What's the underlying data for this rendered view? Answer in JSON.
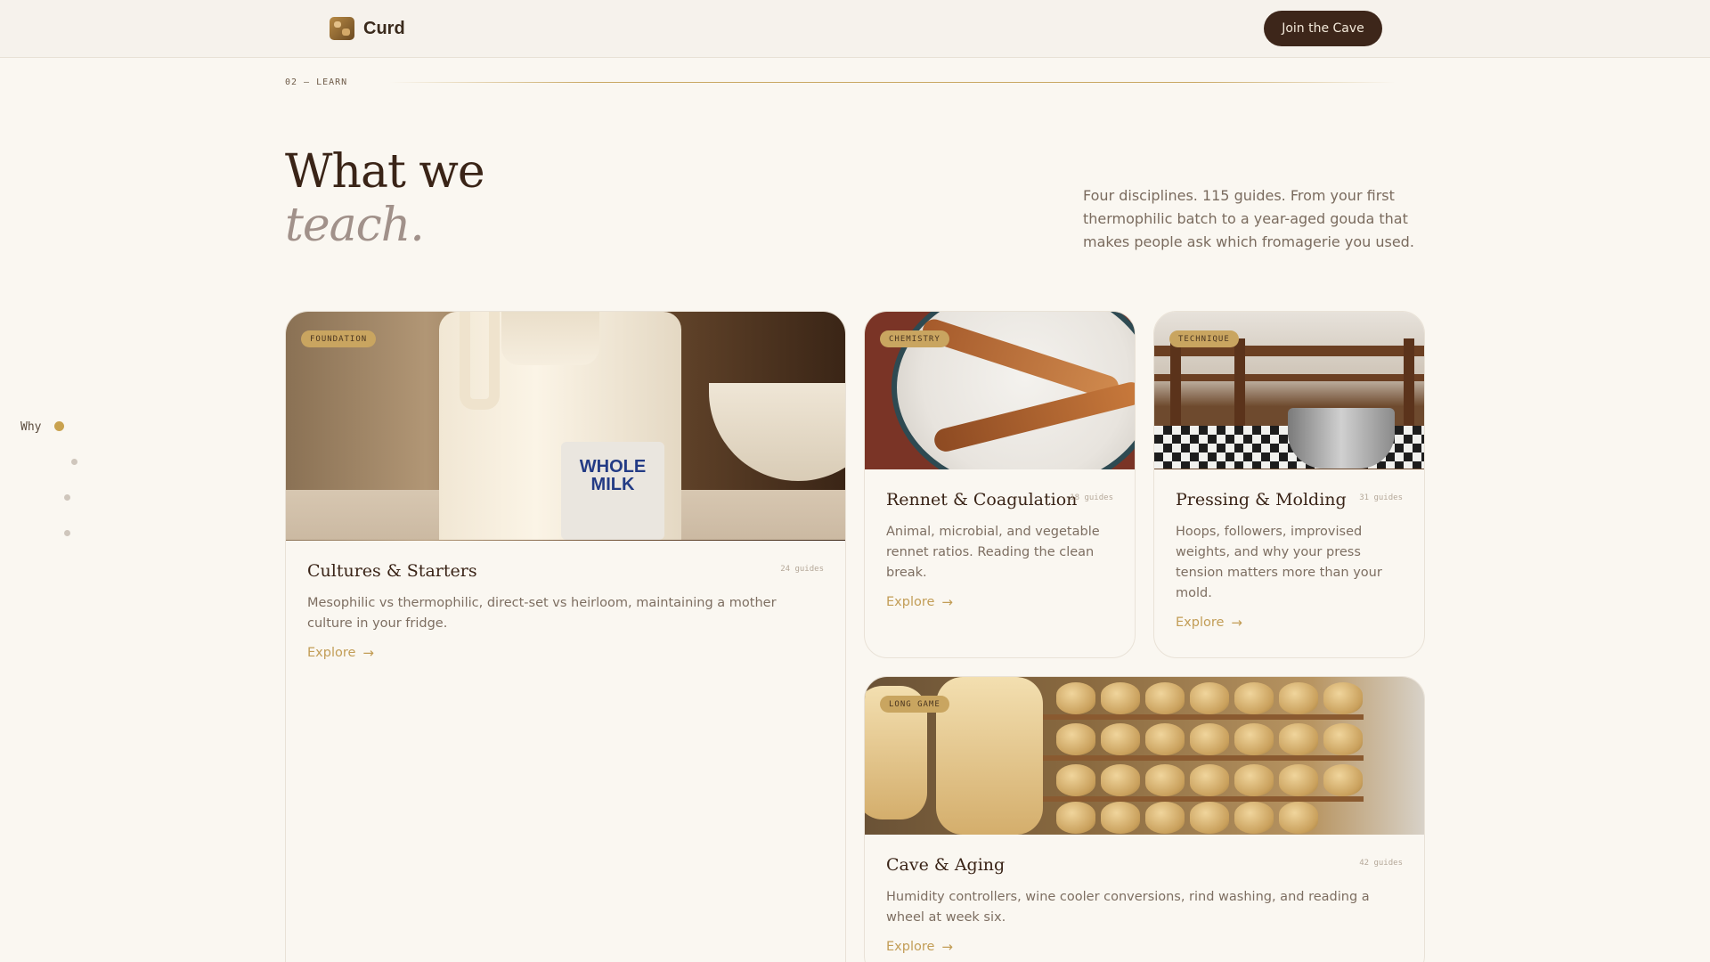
{
  "header": {
    "brand": "Curd",
    "cta_label": "Join the Cave"
  },
  "section": {
    "label": "02 — LEARN",
    "heading_line1": "What we",
    "heading_line2": "teach.",
    "intro": "Four disciplines. 115 guides. From your first thermophilic batch to a year-aged gouda that makes people ask which fromagerie you used."
  },
  "side_nav": {
    "active_label": "Why"
  },
  "cards": [
    {
      "tag": "FOUNDATION",
      "title": "Cultures & Starters",
      "count": "24 guides",
      "description": "Mesophilic vs thermophilic, direct-set vs heirloom, maintaining a mother culture in your fridge.",
      "link": "Explore",
      "image_label_line1": "WHOLE",
      "image_label_line2": "MILK"
    },
    {
      "tag": "CHEMISTRY",
      "title": "Rennet & Coagulation",
      "count": "18 guides",
      "description": "Animal, microbial, and vegetable rennet ratios. Reading the clean break.",
      "link": "Explore"
    },
    {
      "tag": "TECHNIQUE",
      "title": "Pressing & Molding",
      "count": "31 guides",
      "description": "Hoops, followers, improvised weights, and why your press tension matters more than your mold.",
      "link": "Explore"
    },
    {
      "tag": "LONG GAME",
      "title": "Cave & Aging",
      "count": "42 guides",
      "description": "Humidity controllers, wine cooler conversions, rind washing, and reading a wheel at week six.",
      "link": "Explore"
    }
  ],
  "colors": {
    "accent": "#c9a24f",
    "dark": "#3d261a",
    "background": "#faf7f1"
  }
}
